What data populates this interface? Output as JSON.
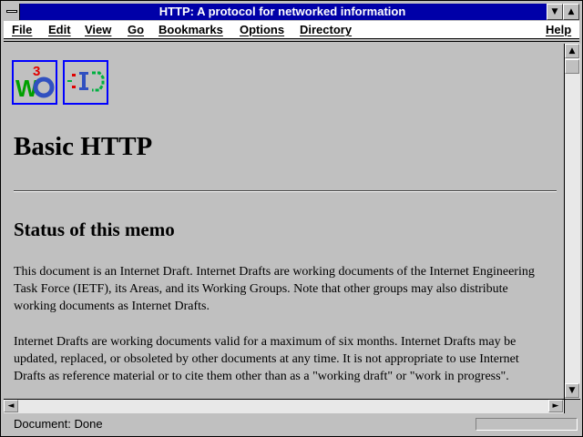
{
  "window": {
    "title": "HTTP: A protocol for networked information",
    "minimize_glyph": "▼",
    "maximize_glyph": "▲"
  },
  "menu": {
    "items": [
      {
        "label": "File",
        "name": "menu-file"
      },
      {
        "label": "Edit",
        "name": "menu-edit"
      },
      {
        "label": "View",
        "name": "menu-view"
      },
      {
        "label": "Go",
        "name": "menu-go"
      },
      {
        "label": "Bookmarks",
        "name": "menu-bookmarks"
      },
      {
        "label": "Options",
        "name": "menu-options"
      },
      {
        "label": "Directory",
        "name": "menu-directory"
      },
      {
        "label": "Help",
        "name": "menu-help"
      }
    ]
  },
  "logos": {
    "w3o": {
      "letters": "W3O"
    },
    "ietf": {
      "letters": "IETF"
    }
  },
  "page": {
    "title": "Basic HTTP",
    "section_title": "Status of this memo",
    "paragraph1": "This document is an Internet Draft. Internet Drafts are working documents of the Internet Engineering Task Force (IETF), its Areas, and its Working Groups. Note that other groups may also distribute working documents as Internet Drafts.",
    "paragraph2": "Internet Drafts are working documents valid for a maximum of six months. Internet Drafts may be updated, replaced, or obsoleted by other documents at any time. It is not appropriate to use Internet Drafts as reference material or to cite them other than as a \"working draft\" or \"work in progress\"."
  },
  "scrollbars": {
    "up": "▲",
    "down": "▼",
    "left": "◄",
    "right": "►"
  },
  "status": {
    "text": "Document: Done",
    "progress": 0
  },
  "colors": {
    "titlebar": "#0000a8",
    "link_border": "#0000ff",
    "background": "#c0c0c0"
  }
}
